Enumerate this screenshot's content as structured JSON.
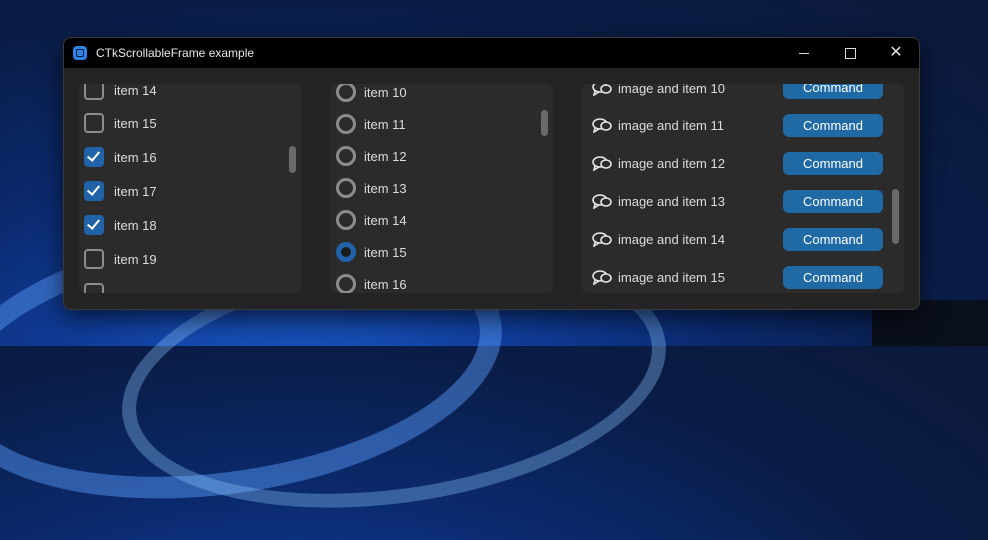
{
  "window": {
    "title": "CTkScrollableFrame example"
  },
  "checkbox_frame": {
    "items": [
      {
        "label": "item 14",
        "checked": false
      },
      {
        "label": "item 15",
        "checked": false
      },
      {
        "label": "item 16",
        "checked": true
      },
      {
        "label": "item 17",
        "checked": true
      },
      {
        "label": "item 18",
        "checked": true
      },
      {
        "label": "item 19",
        "checked": false
      }
    ]
  },
  "radio_frame": {
    "items": [
      {
        "label": "item 10",
        "selected": false
      },
      {
        "label": "item 11",
        "selected": false
      },
      {
        "label": "item 12",
        "selected": false
      },
      {
        "label": "item 13",
        "selected": false
      },
      {
        "label": "item 14",
        "selected": false
      },
      {
        "label": "item 15",
        "selected": true
      },
      {
        "label": "item 16",
        "selected": false
      }
    ]
  },
  "image_frame": {
    "items": [
      {
        "label": "image and item 10",
        "button": "Command"
      },
      {
        "label": "image and item 11",
        "button": "Command"
      },
      {
        "label": "image and item 12",
        "button": "Command"
      },
      {
        "label": "image and item 13",
        "button": "Command"
      },
      {
        "label": "image and item 14",
        "button": "Command"
      },
      {
        "label": "image and item 15",
        "button": "Command"
      }
    ]
  },
  "colors": {
    "accent": "#1f6aa5",
    "frame_bg": "#2b2b2b",
    "window_bg": "#242424"
  },
  "icons": {
    "row_icon": "chat-bubble-icon",
    "app_icon": "ctk-app-icon"
  }
}
